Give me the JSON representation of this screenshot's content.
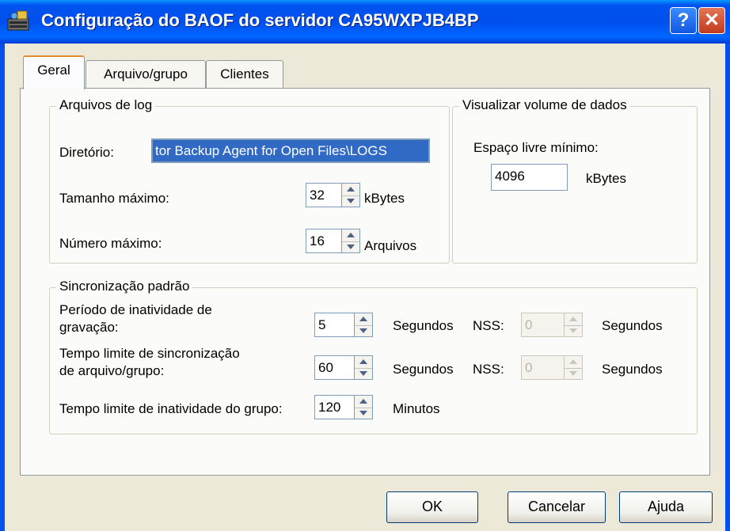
{
  "window": {
    "title": "Configuração do BAOF do servidor CA95WXPJB4BP",
    "help_label": "?",
    "close_label": "✕",
    "icon": "server-config-icon"
  },
  "tabs": [
    {
      "label": "Geral",
      "active": true
    },
    {
      "label": "Arquivo/grupo",
      "active": false
    },
    {
      "label": "Clientes",
      "active": false
    }
  ],
  "log_files": {
    "title": "Arquivos de log",
    "directory_label": "Diretório:",
    "directory_value": "tor Backup Agent for Open Files\\LOGS",
    "max_size_label": "Tamanho máximo:",
    "max_size_value": "32",
    "max_size_unit": "kBytes",
    "max_number_label": "Número máximo:",
    "max_number_value": "16",
    "max_number_unit": "Arquivos"
  },
  "data_volume": {
    "title": "Visualizar volume de dados",
    "min_free_label": "Espaço livre mínimo:",
    "min_free_value": "4096",
    "min_free_unit": "kBytes"
  },
  "sync": {
    "title": "Sincronização padrão",
    "write_inactivity_label_1": "Período de inatividade de",
    "write_inactivity_label_2": "gravação:",
    "write_inactivity_value": "5",
    "write_inactivity_unit": "Segundos",
    "write_nss_label": "NSS:",
    "write_nss_value": "0",
    "write_nss_unit": "Segundos",
    "sync_timeout_label_1": "Tempo limite de sincronização",
    "sync_timeout_label_2": "de arquivo/grupo:",
    "sync_timeout_value": "60",
    "sync_timeout_unit": "Segundos",
    "sync_nss_label": "NSS:",
    "sync_nss_value": "0",
    "sync_nss_unit": "Segundos",
    "group_inactivity_label": "Tempo limite de inatividade do grupo:",
    "group_inactivity_value": "120",
    "group_inactivity_unit": "Minutos"
  },
  "buttons": {
    "ok": "OK",
    "cancel": "Cancelar",
    "help": "Ajuda"
  }
}
